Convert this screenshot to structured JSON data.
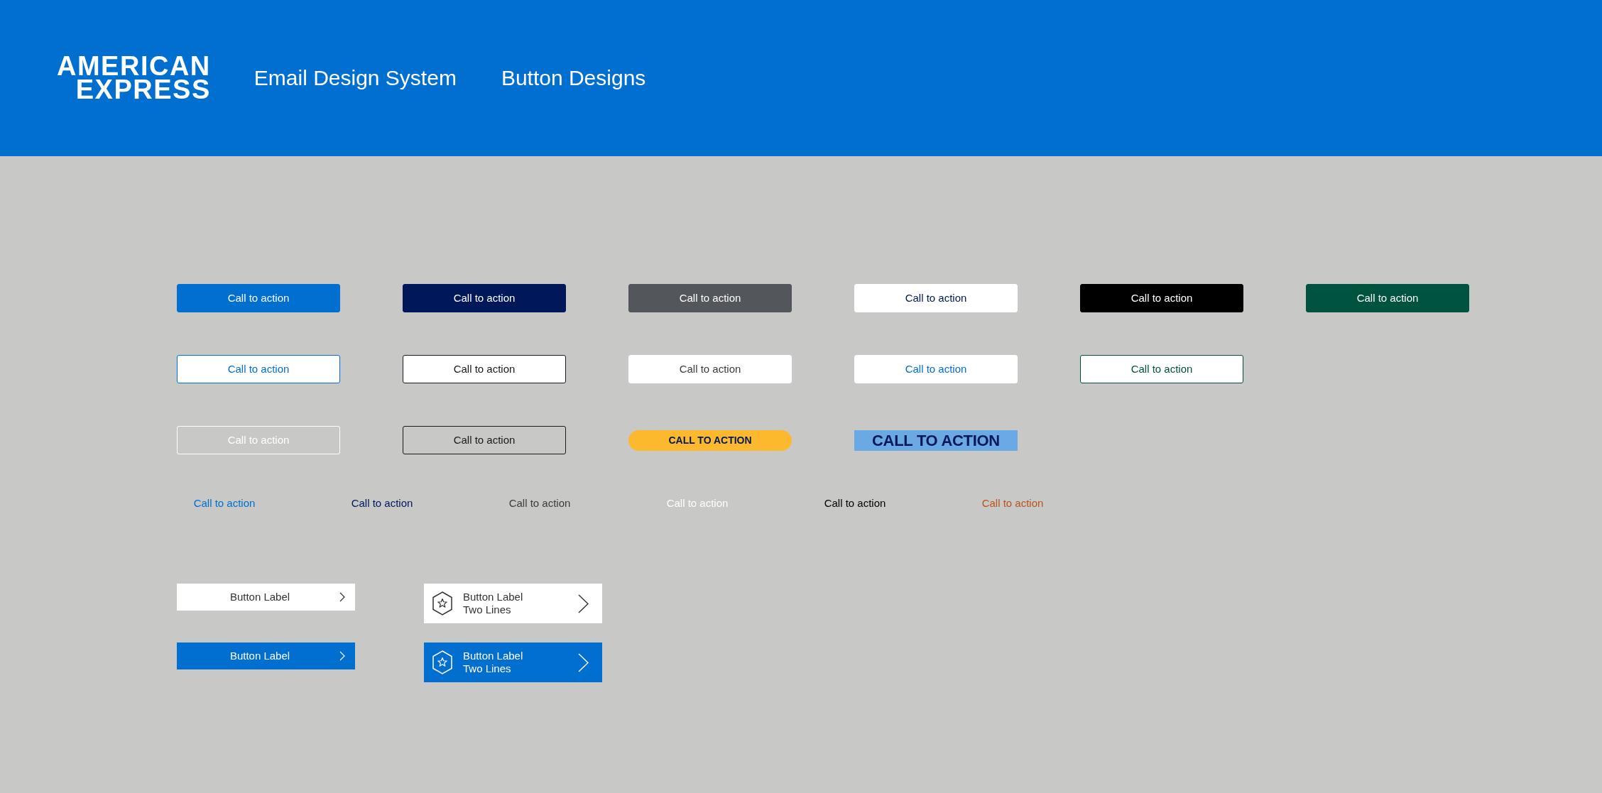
{
  "header": {
    "logo": [
      "AMERICAN",
      "EXPRESS"
    ],
    "titles": [
      "Email Design System",
      "Button Designs"
    ]
  },
  "button_rows": [
    [
      {
        "kind": "filled",
        "color": "#006fcf",
        "label": "Call to action"
      },
      {
        "kind": "filled",
        "color": "#00175a",
        "label": "Call to action"
      },
      {
        "kind": "filled",
        "color": "#53565a",
        "label": "Call to action"
      },
      {
        "kind": "inverse",
        "color": "#00175a",
        "label": "Call to action"
      },
      {
        "kind": "filled",
        "color": "#000000",
        "label": "Call to action"
      },
      {
        "kind": "filled",
        "color": "#00533f",
        "label": "Call to action"
      }
    ],
    [
      {
        "kind": "outline",
        "color": "#006fcf",
        "label": "Call to action"
      },
      {
        "kind": "outline",
        "color": "#1a1a1a",
        "label": "Call to action"
      },
      {
        "kind": "inverse",
        "color": "#3c3c3c",
        "label": "Call to action"
      },
      {
        "kind": "inverse",
        "color": "#006fcf",
        "label": "Call to action"
      },
      {
        "kind": "outline",
        "color": "#00533f",
        "label": "Call to action"
      }
    ],
    [
      {
        "kind": "ghost",
        "color": "#ffffff",
        "label": "Call to action"
      },
      {
        "kind": "ghost",
        "color": "#1a1a1a",
        "label": "Call to action"
      },
      {
        "kind": "pill",
        "color": "#fdb92e",
        "label": "CALL TO ACTION"
      },
      {
        "kind": "banner",
        "color": "#6aa9e3",
        "label": "CALL TO ACTION"
      }
    ]
  ],
  "links": [
    {
      "color": "#006fcf",
      "label": "Call to action"
    },
    {
      "color": "#00175a",
      "label": "Call to action"
    },
    {
      "color": "#3c3c3c",
      "label": "Call to action"
    },
    {
      "color": "#ffffff",
      "label": "Call to action"
    },
    {
      "color": "#000000",
      "label": "Call to action"
    },
    {
      "color": "#b9531f",
      "label": "Call to action"
    }
  ],
  "arrow_button_rows": [
    {
      "kind": "light",
      "buttons": [
        {
          "kind": "single",
          "lines": [
            "Button Label"
          ]
        },
        {
          "kind": "double",
          "lines": [
            "Button Label",
            "Two Lines"
          ]
        }
      ]
    },
    {
      "kind": "solid",
      "buttons": [
        {
          "kind": "single",
          "lines": [
            "Button Label"
          ]
        },
        {
          "kind": "double",
          "lines": [
            "Button Label",
            "Two Lines"
          ]
        }
      ]
    }
  ]
}
